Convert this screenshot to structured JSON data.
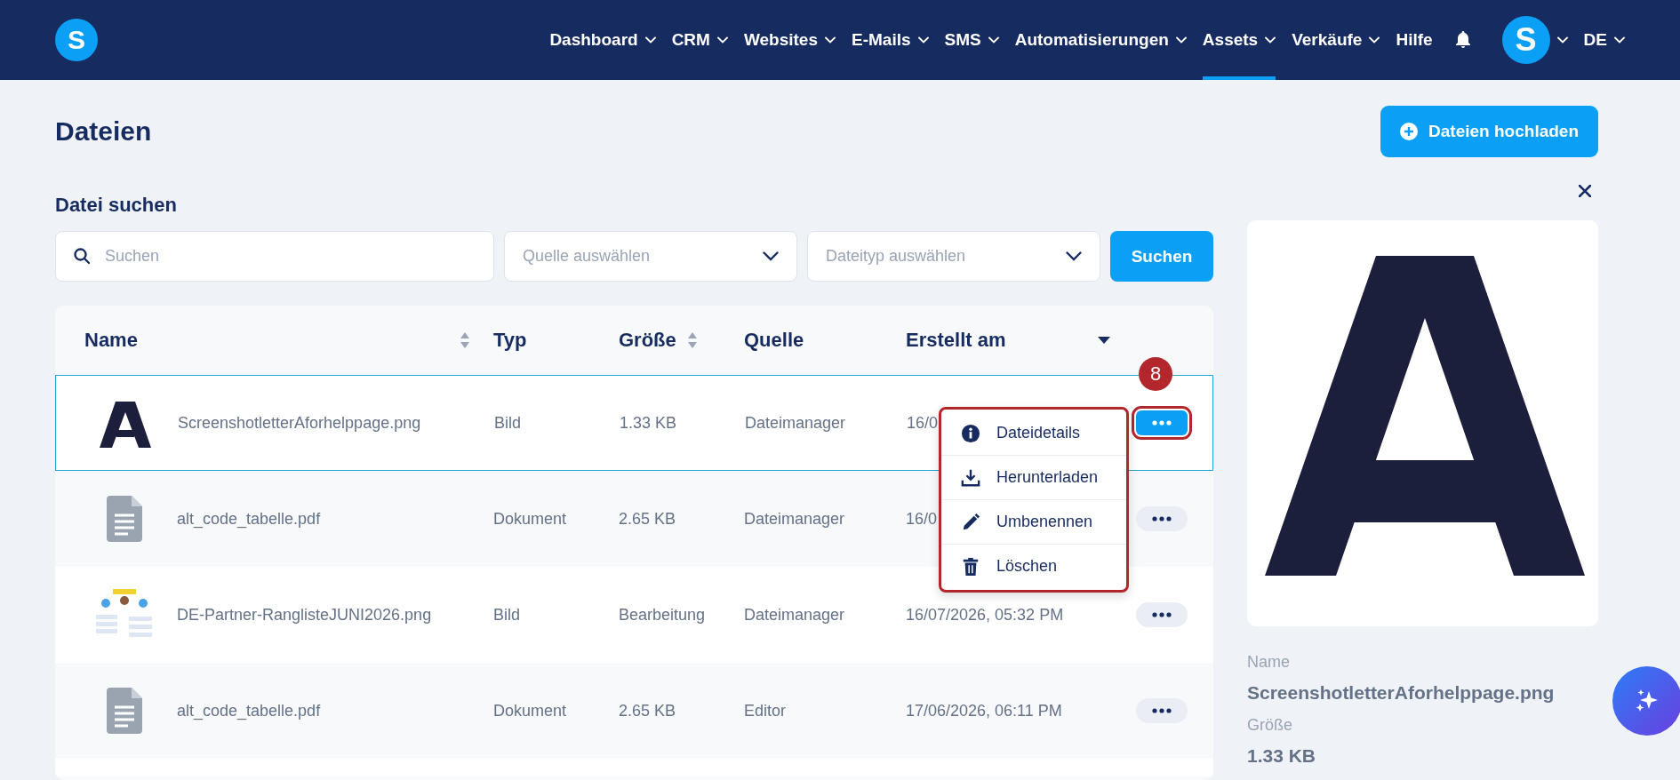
{
  "nav": {
    "logo": "S",
    "items": [
      {
        "label": "Dashboard",
        "has_menu": true,
        "selected": false
      },
      {
        "label": "CRM",
        "has_menu": true,
        "selected": false
      },
      {
        "label": "Websites",
        "has_menu": true,
        "selected": false
      },
      {
        "label": "E-Mails",
        "has_menu": true,
        "selected": false
      },
      {
        "label": "SMS",
        "has_menu": true,
        "selected": false
      },
      {
        "label": "Automatisierungen",
        "has_menu": true,
        "selected": false
      },
      {
        "label": "Assets",
        "has_menu": true,
        "selected": true
      },
      {
        "label": "Verkäufe",
        "has_menu": true,
        "selected": false
      },
      {
        "label": "Hilfe",
        "has_menu": false,
        "selected": false
      }
    ],
    "avatar": "S",
    "language": "DE"
  },
  "page": {
    "title": "Dateien",
    "upload_button": "Dateien hochladen"
  },
  "search": {
    "heading": "Datei suchen",
    "placeholder": "Suchen",
    "source_placeholder": "Quelle auswählen",
    "type_placeholder": "Dateityp auswählen",
    "button": "Suchen"
  },
  "table": {
    "columns": [
      {
        "label": "Name",
        "kind": "sortable"
      },
      {
        "label": "Typ",
        "kind": "plain"
      },
      {
        "label": "Größe",
        "kind": "sortable"
      },
      {
        "label": "Quelle",
        "kind": "plain"
      },
      {
        "label": "Erstellt am",
        "kind": "sorted_desc"
      }
    ],
    "rows": [
      {
        "kind": "picture",
        "name": "ScreenshotletterAforhelppage.png",
        "type": "Bild",
        "size": "1.33 KB",
        "source": "Dateimanager",
        "created": "16/0",
        "selected": true,
        "menu_open": true
      },
      {
        "kind": "document",
        "name": "alt_code_tabelle.pdf",
        "type": "Dokument",
        "size": "2.65 KB",
        "source": "Dateimanager",
        "created": "16/0",
        "selected": false,
        "menu_open": false
      },
      {
        "kind": "picture",
        "name": "DE-Partner-RanglisteJUNI2026.png",
        "type": "Bild",
        "size": "Bearbeitung",
        "source": "Dateimanager",
        "created": "16/07/2026, 05:32 PM",
        "selected": false,
        "menu_open": false
      },
      {
        "kind": "document",
        "name": "alt_code_tabelle.pdf",
        "type": "Dokument",
        "size": "2.65 KB",
        "source": "Editor",
        "created": "17/06/2026, 06:11 PM",
        "selected": false,
        "menu_open": false
      }
    ]
  },
  "row_menu": {
    "annotation": "8",
    "items": [
      {
        "kind": "info",
        "label": "Dateidetails"
      },
      {
        "kind": "download",
        "label": "Herunterladen"
      },
      {
        "kind": "edit",
        "label": "Umbenennen"
      },
      {
        "kind": "delete",
        "label": "Löschen"
      }
    ]
  },
  "details": {
    "fields": [
      {
        "label": "Name",
        "value": "ScreenshotletterAforhelppage.png"
      },
      {
        "label": "Größe",
        "value": "1.33 KB"
      }
    ]
  }
}
